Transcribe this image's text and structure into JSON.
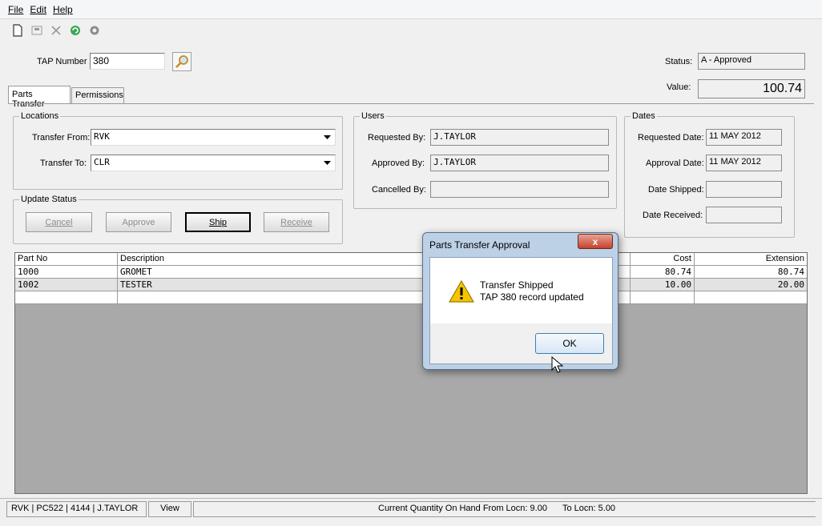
{
  "menu": {
    "file": "File",
    "edit": "Edit",
    "help": "Help"
  },
  "header": {
    "tap_label": "TAP Number",
    "tap_value": "380",
    "status_label": "Status:",
    "status_value": "A - Approved",
    "value_label": "Value:",
    "value_value": "100.74"
  },
  "tabs": {
    "parts_transfer": "Parts Transfer",
    "permissions": "Permissions"
  },
  "locations": {
    "title": "Locations",
    "from_label": "Transfer From:",
    "from_value": "RVK",
    "to_label": "Transfer To:",
    "to_value": "CLR"
  },
  "users": {
    "title": "Users",
    "requested_label": "Requested By:",
    "requested_value": "J.TAYLOR",
    "approved_label": "Approved By:",
    "approved_value": "J.TAYLOR",
    "cancelled_label": "Cancelled By:",
    "cancelled_value": ""
  },
  "dates": {
    "title": "Dates",
    "requested_label": "Requested Date:",
    "requested_value": "11 MAY 2012",
    "approval_label": "Approval Date:",
    "approval_value": "11 MAY 2012",
    "shipped_label": "Date Shipped:",
    "shipped_value": "",
    "received_label": "Date Received:",
    "received_value": ""
  },
  "update_status": {
    "title": "Update Status",
    "cancel": "Cancel",
    "approve": "Approve",
    "ship": "Ship",
    "receive": "Receive"
  },
  "grid": {
    "columns": {
      "part_no": "Part No",
      "description": "Description",
      "cost": "Cost",
      "extension": "Extension"
    },
    "rows": [
      {
        "part_no": "1000",
        "description": "GROMET",
        "cost": "80.74",
        "extension": "80.74"
      },
      {
        "part_no": "1002",
        "description": "TESTER",
        "cost": "10.00",
        "extension": "20.00"
      }
    ]
  },
  "statusbar": {
    "context": "RVK | PC522 | 4144 | J.TAYLOR",
    "view": "View",
    "qty_text": "Current Quantity On Hand From Locn: 9.00",
    "to_text": "To Locn: 5.00"
  },
  "dialog": {
    "title": "Parts Transfer Approval",
    "line1": "Transfer Shipped",
    "line2": "TAP 380 record updated",
    "ok": "OK",
    "close": "x"
  }
}
